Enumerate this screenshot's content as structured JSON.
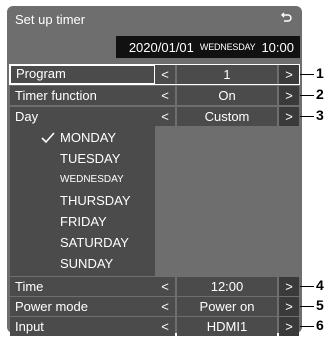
{
  "screen": {
    "title": "Set up timer",
    "back_icon": "return-icon"
  },
  "datebar": {
    "date": "2020/01/01",
    "weekday": "WEDNESDAY",
    "time": "10:00"
  },
  "rows": [
    {
      "label": "Program",
      "value": "1",
      "left_arrow": "<",
      "right_arrow": ">"
    },
    {
      "label": "Timer function",
      "value": "On",
      "left_arrow": "<",
      "right_arrow": ">"
    },
    {
      "label": "Day",
      "value": "Custom",
      "left_arrow": "<",
      "right_arrow": ">"
    },
    {
      "label": "Time",
      "value": "12:00",
      "left_arrow": "<",
      "right_arrow": ">"
    },
    {
      "label": "Power mode",
      "value": "Power on",
      "left_arrow": "<",
      "right_arrow": ">"
    },
    {
      "label": "Input",
      "value": "HDMI1",
      "left_arrow": "<",
      "right_arrow": ">"
    }
  ],
  "days": [
    {
      "name": "MONDAY",
      "checked": true
    },
    {
      "name": "TUESDAY",
      "checked": false
    },
    {
      "name": "WEDNESDAY",
      "checked": false
    },
    {
      "name": "THURSDAY",
      "checked": false
    },
    {
      "name": "FRIDAY",
      "checked": false
    },
    {
      "name": "SATURDAY",
      "checked": false
    },
    {
      "name": "SUNDAY",
      "checked": false
    }
  ],
  "callouts": [
    "1",
    "2",
    "3",
    "4",
    "5",
    "6"
  ]
}
